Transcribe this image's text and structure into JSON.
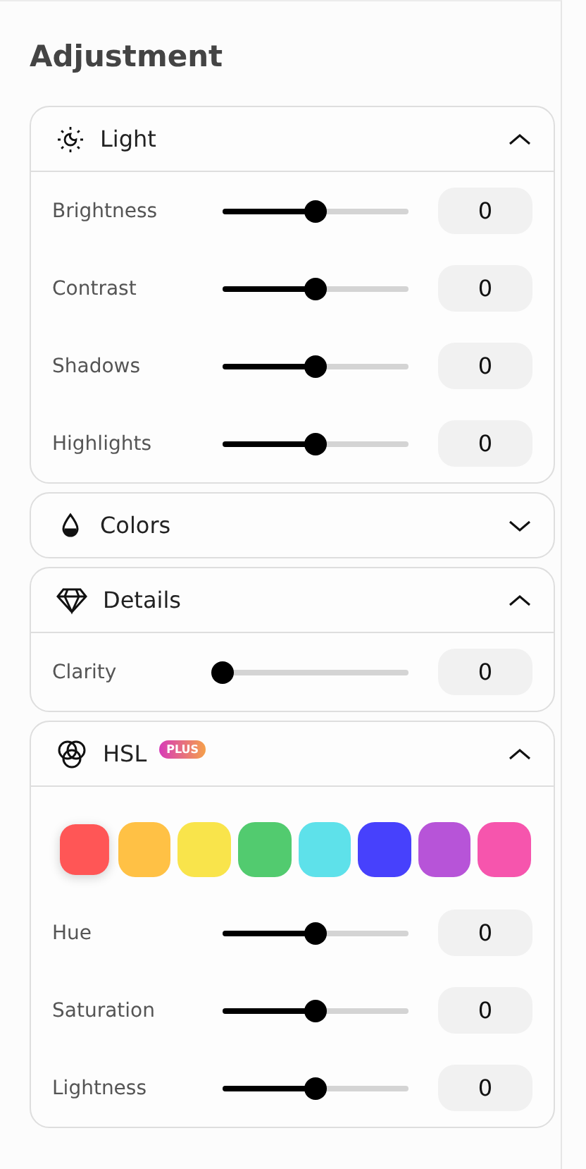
{
  "title": "Adjustment",
  "sections": [
    {
      "title": "Light",
      "expanded": true,
      "sliders": [
        {
          "label": "Brightness",
          "level": 0.5,
          "value": "0"
        },
        {
          "label": "Contrast",
          "level": 0.5,
          "value": "0"
        },
        {
          "label": "Shadows",
          "level": 0.5,
          "value": "0"
        },
        {
          "label": "Highlights",
          "level": 0.5,
          "value": "0"
        }
      ]
    },
    {
      "title": "Colors",
      "expanded": false
    },
    {
      "title": "Details",
      "expanded": true,
      "sliders": [
        {
          "label": "Clarity",
          "level": 0,
          "value": "0"
        }
      ]
    },
    {
      "title": "HSL",
      "badge": "PLUS",
      "expanded": true,
      "swatches": [
        {
          "color": "#ff5656",
          "selected": true
        },
        {
          "color": "#ffc145",
          "selected": false
        },
        {
          "color": "#f9e44b",
          "selected": false
        },
        {
          "color": "#52cb6f",
          "selected": false
        },
        {
          "color": "#5ee1ea",
          "selected": false
        },
        {
          "color": "#4741fc",
          "selected": false
        },
        {
          "color": "#b754d8",
          "selected": false
        },
        {
          "color": "#f655ad",
          "selected": false
        }
      ],
      "sliders": [
        {
          "label": "Hue",
          "level": 0.5,
          "value": "0"
        },
        {
          "label": "Saturation",
          "level": 0.5,
          "value": "0"
        },
        {
          "label": "Lightness",
          "level": 0.5,
          "value": "0"
        }
      ]
    }
  ]
}
